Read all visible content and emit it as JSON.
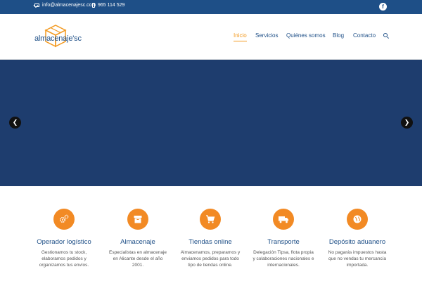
{
  "topbar": {
    "email": "info@almacenajesc.com",
    "phone": "965 114 529",
    "social_icon": "facebook-icon",
    "social_glyph": "f"
  },
  "header": {
    "logo_text": "almacenaje'sc",
    "nav": [
      {
        "label": "Inicio",
        "active": true
      },
      {
        "label": "Servicios",
        "active": false
      },
      {
        "label": "Quiénes somos",
        "active": false
      },
      {
        "label": "Blog",
        "active": false
      },
      {
        "label": "Contacto",
        "active": false
      }
    ],
    "search_icon": "search-icon"
  },
  "slider": {
    "prev_glyph": "❮",
    "next_glyph": "❯"
  },
  "features": [
    {
      "icon": "gears-icon",
      "title": "Operador logístico",
      "desc": "Gestionamos tu stock, elaboramos pedidos y organizamos tus envíos."
    },
    {
      "icon": "archive-box-icon",
      "title": "Almacenaje",
      "desc": "Especialistas en almacenaje en Alicante desde el año 2001."
    },
    {
      "icon": "shopping-cart-icon",
      "title": "Tiendas online",
      "desc": "Almacenamos, preparamos y enviamos pedidos para todo tipo de tiendas online."
    },
    {
      "icon": "truck-icon",
      "title": "Transporte",
      "desc": "Delegación Tipsa, flota propia y colaboraciones nacionales e internacionales."
    },
    {
      "icon": "globe-icon",
      "title": "Depósito aduanero",
      "desc": "No pagarás impuestos hasta que no vendas tu mercancía importada."
    }
  ],
  "colors": {
    "topbar": "#1e4f87",
    "slider": "#1e3d6e",
    "accent": "#f39a21",
    "icon_circle": "#f28a24",
    "link": "#1e4f87"
  }
}
